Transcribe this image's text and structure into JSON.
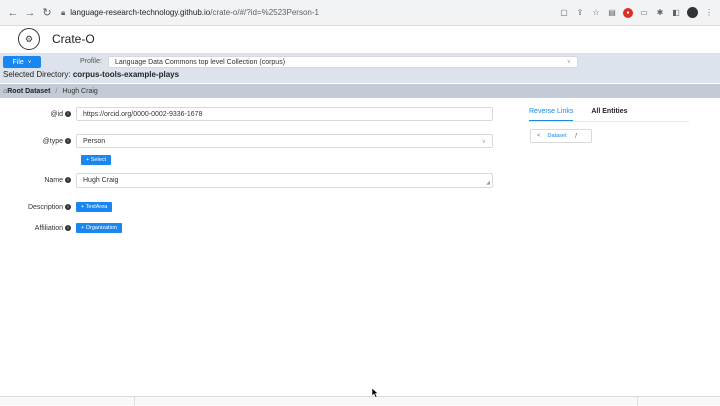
{
  "browser": {
    "url_host": "language-research-technology.github.io",
    "url_path": "/crate-o/#/?id=%2523Person-1"
  },
  "app": {
    "title": "Crate-O"
  },
  "toolbar": {
    "file_label": "File",
    "profile_label": "Profile:",
    "profile_value": "Language Data Commons top level Collection (corpus)",
    "selected_dir_label": "Selected Directory:",
    "selected_dir_value": "corpus-tools-example-plays"
  },
  "breadcrumb": {
    "root": "Root Dataset",
    "current": "Hugh Craig"
  },
  "form": {
    "id_label": "@id",
    "id_value": "https://orcid.org/0000-0002-9336-1678",
    "type_label": "@type",
    "type_value": "Person",
    "select_button": "+ Select",
    "name_label": "Name",
    "name_value": "Hugh Craig",
    "description_label": "Description",
    "textarea_button": "+ TextArea",
    "affiliation_label": "Affiliation",
    "organization_button": "+ Organization"
  },
  "side_panel": {
    "tab_reverse_links": "Reverse Links",
    "tab_all_entities": "All Entities",
    "dataset_link": "Dataset",
    "dataset_fn": "ƒ"
  },
  "colors": {
    "accent": "#1a87f0",
    "toolbar_bg": "#dde3ec",
    "breadcrumb_bg": "#c3cbd6"
  }
}
